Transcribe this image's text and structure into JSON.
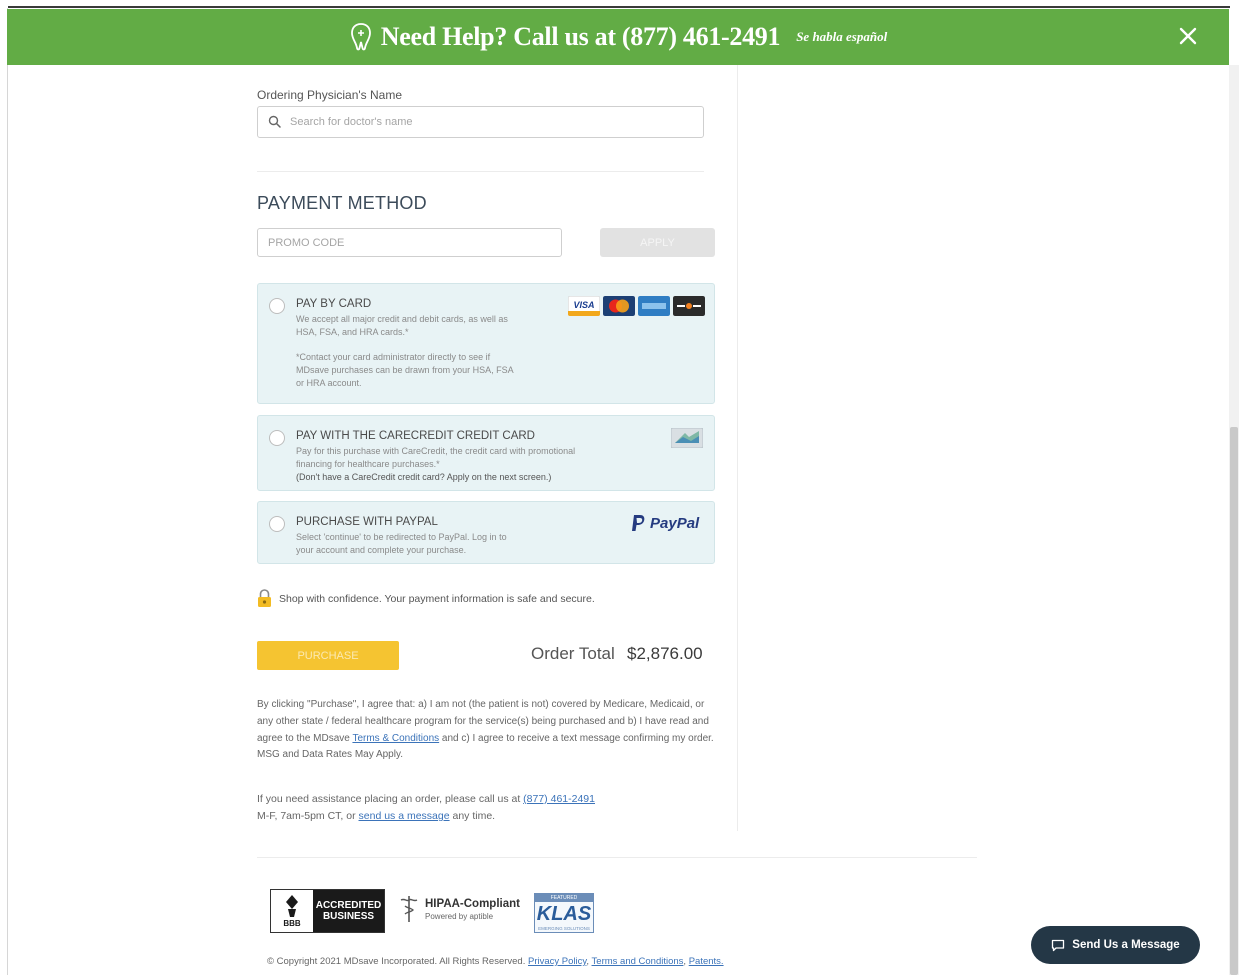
{
  "banner": {
    "text": "Need Help? Call us at (877) 461-2491",
    "spanish": "Se habla español",
    "color": "#62ac45"
  },
  "physician": {
    "label": "Ordering Physician's Name",
    "placeholder": "Search for doctor's name"
  },
  "payment": {
    "title": "PAYMENT METHOD",
    "promo_placeholder": "PROMO CODE",
    "apply_label": "APPLY",
    "options": [
      {
        "title": "PAY BY CARD",
        "desc1": "We accept all major credit and debit cards, as well as",
        "desc2": "HSA, FSA, and HRA cards.*",
        "note1": "*Contact your card administrator directly to see if",
        "note2": "MDsave purchases can be drawn from your HSA, FSA",
        "note3": "or HRA account.",
        "logos": [
          "visa-logo",
          "mastercard-logo",
          "amex-logo",
          "discover-logo"
        ]
      },
      {
        "title": "PAY WITH THE CARECREDIT CREDIT CARD",
        "desc1": "Pay for this purchase with CareCredit, the credit card with promotional",
        "desc2": "financing for healthcare purchases.*",
        "desc3": "(Don't have a CareCredit credit card? Apply on the next screen.)"
      },
      {
        "title": "PURCHASE WITH PAYPAL",
        "desc1": "Select 'continue' to be redirected to PayPal. Log in to",
        "desc2": "your account and complete your purchase.",
        "brand": "PayPal"
      }
    ]
  },
  "secure_text": "Shop with confidence. Your payment information is safe and secure.",
  "purchase": {
    "button": "PURCHASE",
    "total_label": "Order Total",
    "total_value": "$2,876.00",
    "accent_color": "#f5c431"
  },
  "legal": {
    "part1": "By clicking \"Purchase\", I agree that: a) I am not (the patient is not) covered by Medicare, Medicaid, or any other state / federal healthcare program for the service(s) being purchased and b) I have read and agree to the MDsave ",
    "terms_link": "Terms & Conditions",
    "part2": " and c) I agree to receive a text message confirming my order. MSG and Data Rates May Apply."
  },
  "assist": {
    "part1": "If you need assistance placing an order, please call us at ",
    "phone_link": "(877) 461-2491",
    "part2": "M-F, 7am-5pm CT, or ",
    "message_link": "send us a message",
    "part3": " any time."
  },
  "footer": {
    "bbb_text": "ACCREDITED BUSINESS",
    "bbb_logo": "BBB",
    "hipaa_title": "HIPAA-Compliant",
    "hipaa_sub": "Powered by aptible",
    "klas_top": "FEATURED",
    "klas_text": "KLAS",
    "klas_bottom": "EMERGING SOLUTIONS",
    "copyright": "© Copyright 2021 MDsave Incorporated. All Rights Reserved.",
    "privacy": "Privacy Policy",
    "terms": "Terms and Conditions",
    "patents": "Patents."
  },
  "message_button": "Send Us a Message"
}
